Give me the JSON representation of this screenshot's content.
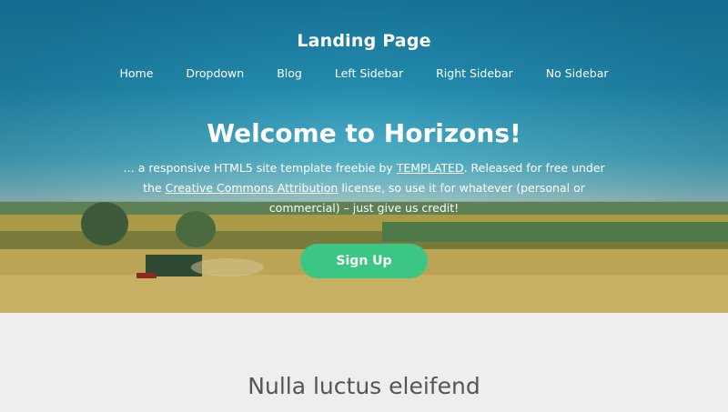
{
  "header": {
    "site_title": "Landing Page",
    "nav": [
      {
        "label": "Home"
      },
      {
        "label": "Dropdown"
      },
      {
        "label": "Blog"
      },
      {
        "label": "Left Sidebar"
      },
      {
        "label": "Right Sidebar"
      },
      {
        "label": "No Sidebar"
      }
    ]
  },
  "hero": {
    "headline": "Welcome to Horizons!",
    "tagline_part1": "… a responsive HTML5 site template freebie by ",
    "tagline_link1": "TEMPLATED",
    "tagline_part2": ". Released for free under the ",
    "tagline_link2": "Creative Commons Attribution",
    "tagline_part3": " license, so use it for whatever (personal or commercial) – just give us credit!",
    "cta_label": "Sign Up",
    "cta_color": "#3cc683"
  },
  "section": {
    "title": "Nulla luctus eleifend",
    "subtitle": ""
  }
}
